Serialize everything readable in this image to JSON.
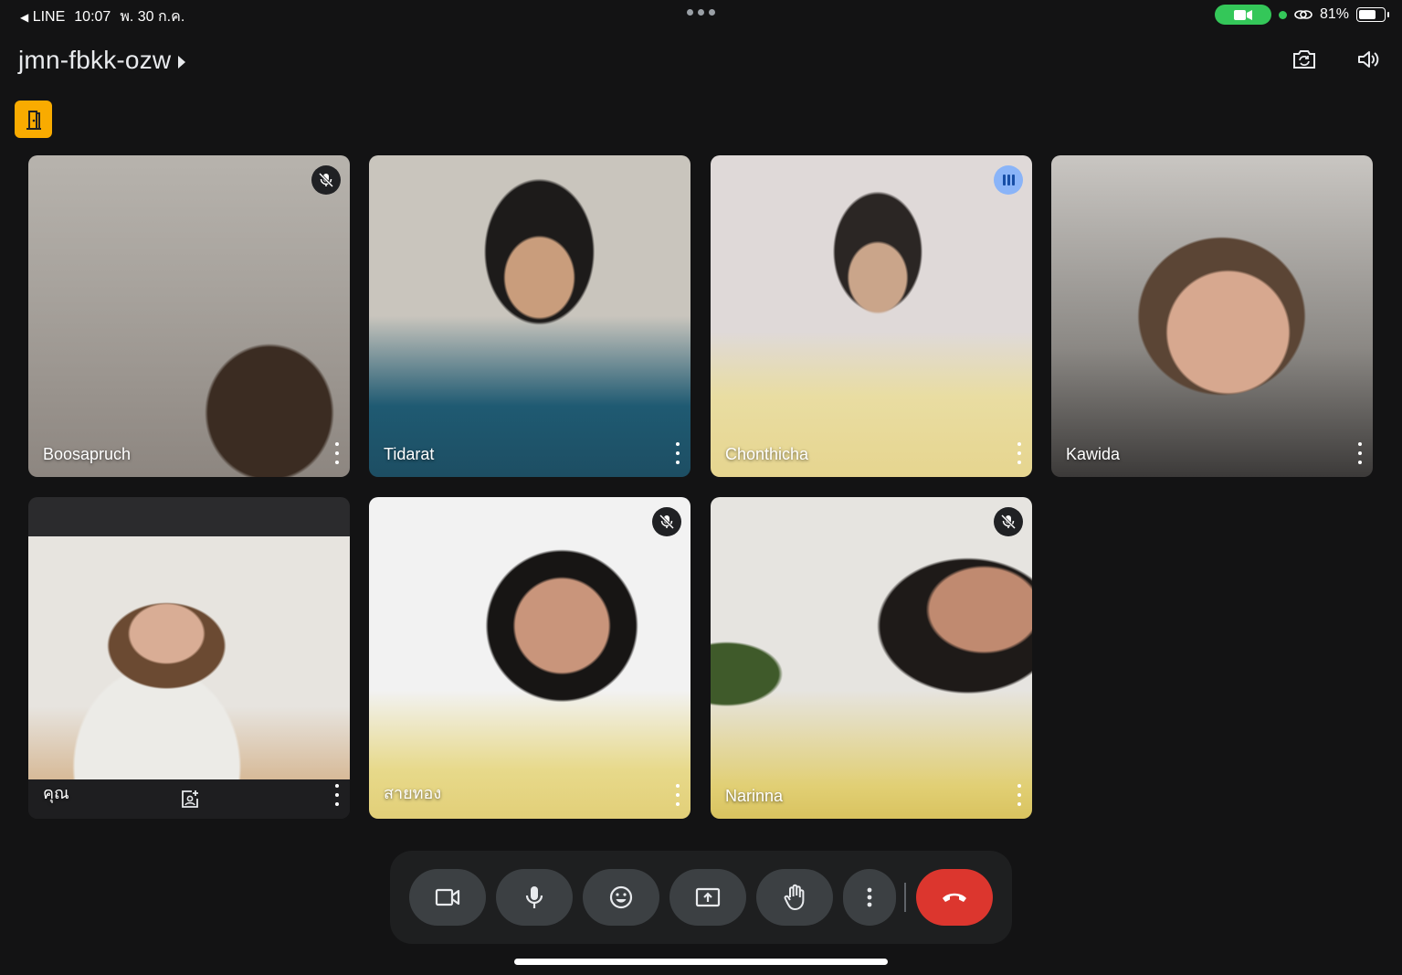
{
  "status_bar": {
    "back_app": "LINE",
    "time": "10:07",
    "date": "พ. 30 ก.ค.",
    "battery": "81%",
    "battery_level": 0.81
  },
  "meeting": {
    "code": "jmn-fbkk-ozw"
  },
  "participants": [
    {
      "name": "Boosapruch",
      "muted": true,
      "speaking": false
    },
    {
      "name": "Tidarat",
      "muted": false,
      "speaking": false
    },
    {
      "name": "Chonthicha",
      "muted": false,
      "speaking": true
    },
    {
      "name": "Kawida",
      "muted": false,
      "speaking": false
    },
    {
      "name": "คุณ",
      "muted": false,
      "speaking": false,
      "is_self": true
    },
    {
      "name": "สายทอง",
      "muted": true,
      "speaking": false
    },
    {
      "name": "Narinna",
      "muted": true,
      "speaking": false
    }
  ],
  "colors": {
    "background": "#131314",
    "room_badge": "#f9ab00",
    "hangup": "#dc362e",
    "control": "#3c4043",
    "camera_indicator": "#34c759"
  },
  "icons": {
    "camera": "video-camera-icon",
    "mic": "microphone-icon",
    "reactions": "emoji-icon",
    "present": "present-screen-icon",
    "raise_hand": "raise-hand-icon",
    "more": "more-vertical-icon",
    "hangup": "hangup-icon"
  }
}
